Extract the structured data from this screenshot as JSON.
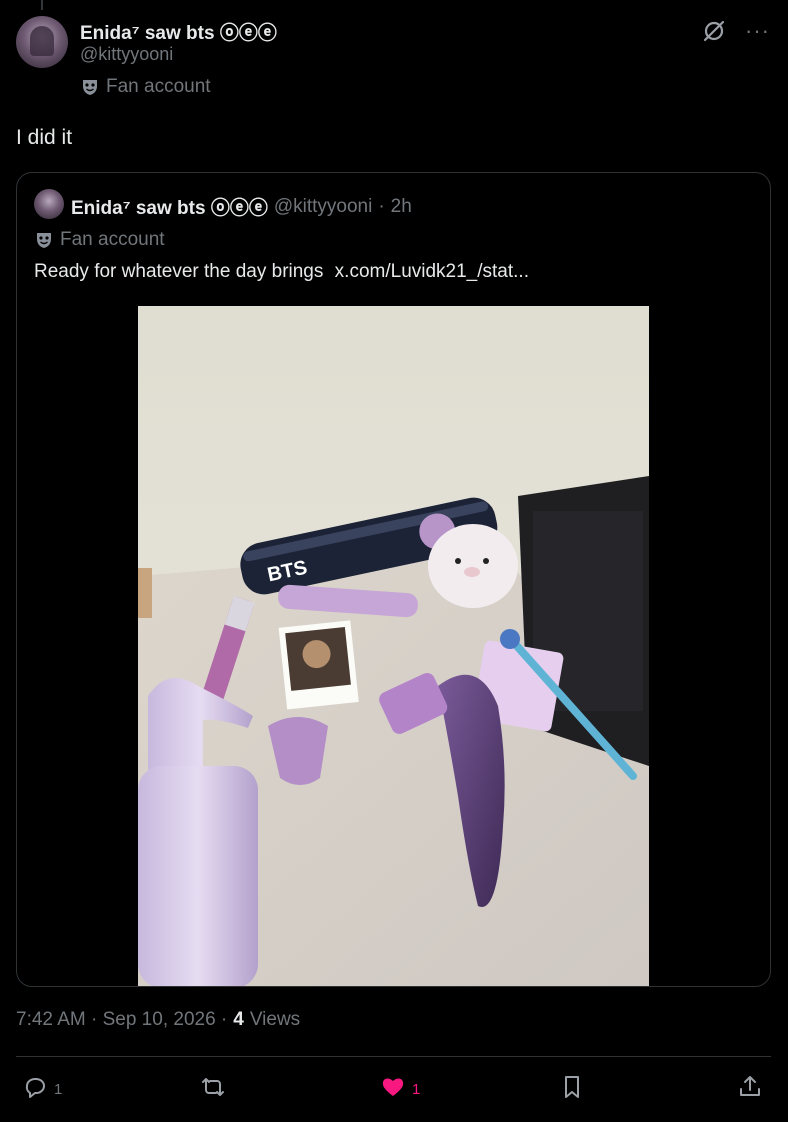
{
  "author": {
    "display_name": "Enida⁷ saw bts ⓞⓔⓔ",
    "handle": "@kittyyooni",
    "badge": "Fan account",
    "avatar_icon": "avatar-photo"
  },
  "tweet": {
    "text": "I did it",
    "timestamp": "7:42 AM · Sep 10, 2026 ·",
    "views_count": "4",
    "views_label": "Views"
  },
  "quote": {
    "display_name": "Enida⁷ saw bts ⓞⓔⓔ",
    "handle": "@kittyyooni",
    "separator": "·",
    "time": "2h",
    "badge": "Fan account",
    "text": "Ready for whatever the day brings",
    "link": "x.com/Luvidk21_/stat...",
    "media_label": "BTS"
  },
  "actions": {
    "reply_count": "1",
    "retweet_count": "",
    "like_count": "1",
    "like_color": "#f91880"
  },
  "icons": {
    "grok": "grok-icon",
    "more": "more-icon",
    "badge": "mask-icon",
    "reply": "reply-icon",
    "retweet": "retweet-icon",
    "like": "heart-icon",
    "bookmark": "bookmark-icon",
    "share": "share-icon"
  },
  "more_glyph": "···"
}
